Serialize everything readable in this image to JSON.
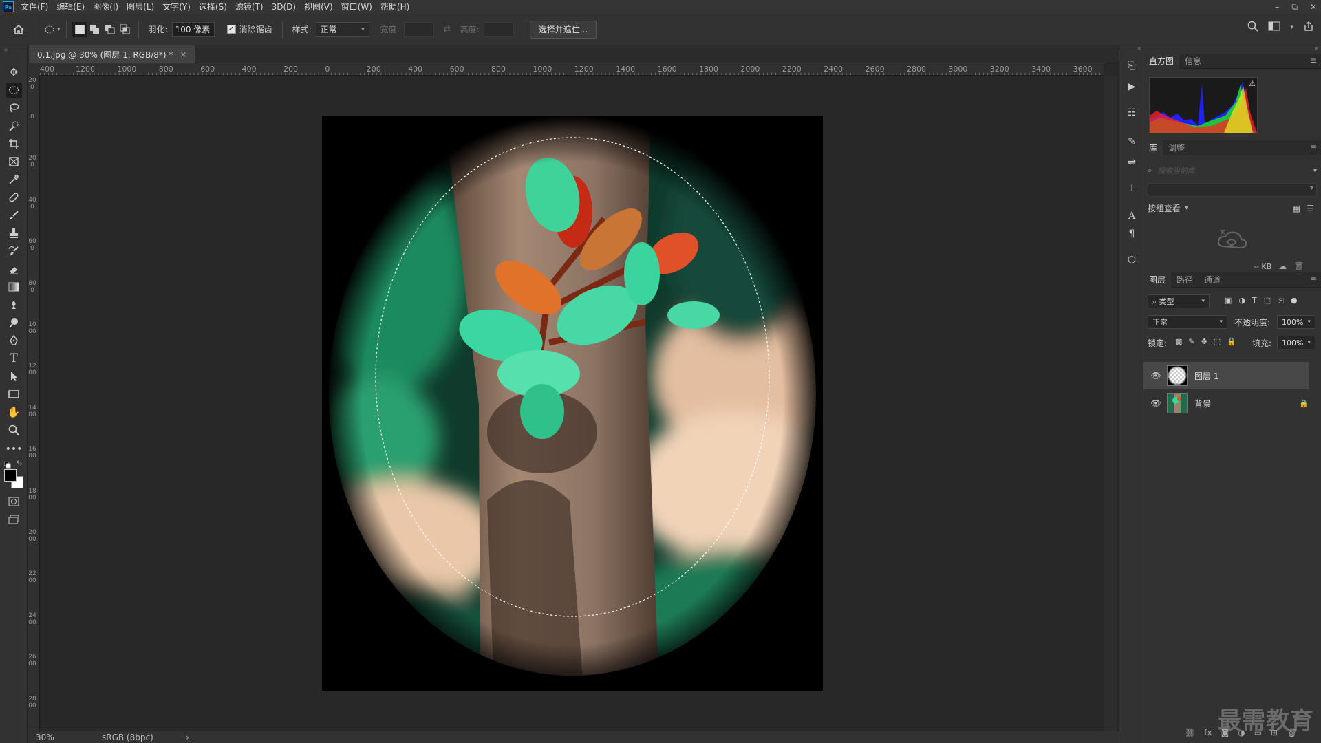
{
  "app": {
    "logo": "Ps",
    "document_tab": "0.1.jpg @ 30% (图层 1, RGB/8*) *",
    "tab_close": "×"
  },
  "menu": [
    "文件(F)",
    "编辑(E)",
    "图像(I)",
    "图层(L)",
    "文字(Y)",
    "选择(S)",
    "滤镜(T)",
    "3D(D)",
    "视图(V)",
    "窗口(W)",
    "帮助(H)"
  ],
  "window_controls": {
    "minimize": "–",
    "restore": "⧉",
    "close": "✕"
  },
  "options": {
    "feather_label": "羽化:",
    "feather_value": "100 像素",
    "antialias_label": "消除锯齿",
    "antialias_checked": "✓",
    "style_label": "样式:",
    "style_value": "正常",
    "width_label": "宽度:",
    "height_label": "高度:",
    "select_mask_button": "选择并遮住..."
  },
  "ruler": {
    "h_labels": [
      "400",
      "1200",
      "1000",
      "800",
      "600",
      "400",
      "200",
      "0",
      "200",
      "400",
      "600",
      "800",
      "1000",
      "1200",
      "1400",
      "1600",
      "1800",
      "2000",
      "2200",
      "2400",
      "2600",
      "2800",
      "3000",
      "3200",
      "3400",
      "3600"
    ],
    "v_labels": [
      "200",
      "0",
      "200",
      "400",
      "600",
      "800",
      "1000",
      "1200",
      "1400",
      "1600",
      "1800",
      "2000",
      "2200",
      "2400",
      "2600",
      "2800"
    ]
  },
  "status": {
    "zoom": "30%",
    "color_profile": "sRGB (8bpc)",
    "arrow": "›"
  },
  "histogram_panel": {
    "tabs": [
      "直方图",
      "信息"
    ],
    "warning": "⚠"
  },
  "library_panel": {
    "tabs": [
      "库",
      "调整"
    ],
    "search_placeholder": "搜索当前库",
    "view_label": "按组查看",
    "size": "-- KB"
  },
  "layers_panel": {
    "tabs": [
      "图层",
      "路径",
      "通道"
    ],
    "filter_label": "类型",
    "blend_mode": "正常",
    "opacity_label": "不透明度:",
    "opacity_value": "100%",
    "lock_label": "锁定:",
    "fill_label": "填充:",
    "fill_value": "100%",
    "layers": [
      {
        "name": "图层 1",
        "selected": true
      },
      {
        "name": "背景",
        "locked": true
      }
    ]
  },
  "watermark": "最需教育",
  "colors": {
    "panel_bg": "#323232",
    "canvas_bg": "#282828",
    "selected_layer": "#484848"
  }
}
